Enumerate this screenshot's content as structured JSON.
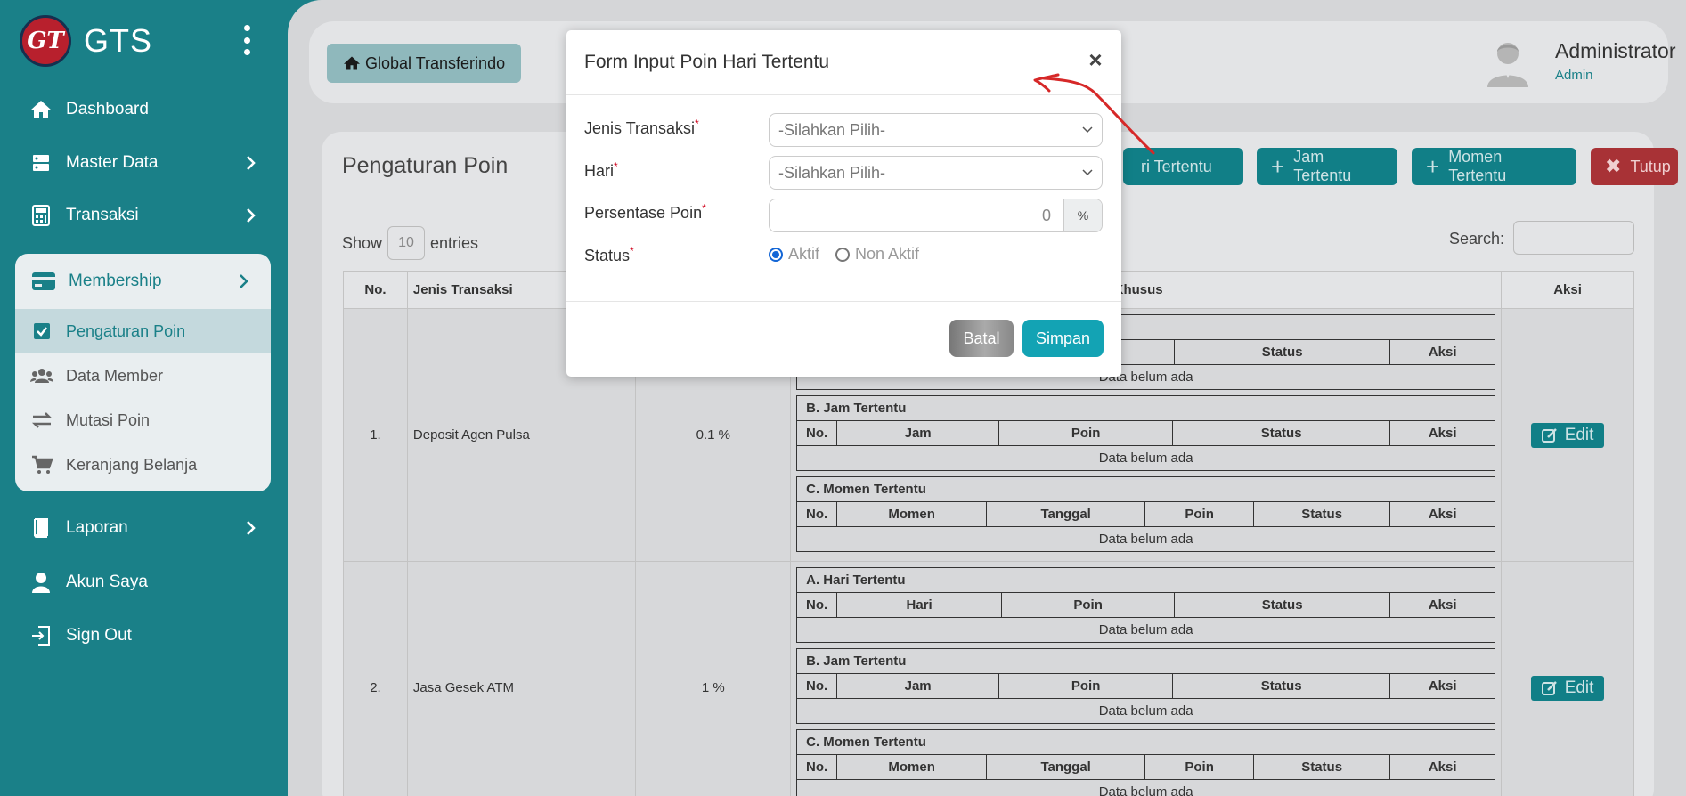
{
  "brand": {
    "logo_text": "GT",
    "name": "GTS"
  },
  "sidebar": {
    "items": [
      {
        "label": "Dashboard",
        "icon": "home-icon"
      },
      {
        "label": "Master Data",
        "icon": "server-icon"
      },
      {
        "label": "Transaksi",
        "icon": "calculator-icon"
      },
      {
        "label": "Membership",
        "icon": "card-icon"
      },
      {
        "label": "Laporan",
        "icon": "book-icon"
      },
      {
        "label": "Akun Saya",
        "icon": "user-icon"
      },
      {
        "label": "Sign Out",
        "icon": "signout-icon"
      }
    ],
    "membership_sub": [
      {
        "label": "Pengaturan Poin",
        "icon": "check-square-icon"
      },
      {
        "label": "Data Member",
        "icon": "users-icon"
      },
      {
        "label": "Mutasi Poin",
        "icon": "exchange-icon"
      },
      {
        "label": "Keranjang Belanja",
        "icon": "cart-icon"
      }
    ]
  },
  "topbar": {
    "breadcrumb": "Global Transferindo",
    "user_name": "Administrator",
    "user_role": "Admin"
  },
  "page": {
    "title": "Pengaturan Poin",
    "actions": {
      "hari": "ri Tertentu",
      "jam": "Jam Tertentu",
      "momen": "Momen Tertentu",
      "tutup": "Tutup"
    },
    "show_label": "Show",
    "entries_value": "10",
    "entries_label": "entries",
    "search_label": "Search:"
  },
  "table": {
    "headers": {
      "no": "No.",
      "jenis": "Jenis Transaksi",
      "khusus": "in Khusus",
      "aksi": "Aksi"
    },
    "rows": [
      {
        "no": "1.",
        "jenis": "Deposit Agen Pulsa",
        "poin": "0.1 %"
      },
      {
        "no": "2.",
        "jenis": "Jasa Gesek ATM",
        "poin": "1 %"
      }
    ],
    "sub": {
      "hari_title": "A. Hari Tertentu",
      "jam_title": "B. Jam Tertentu",
      "momen_title": "C. Momen Tertentu",
      "no": "No.",
      "hari": "Hari",
      "jam": "Jam",
      "momen": "Momen",
      "tanggal": "Tanggal",
      "poin": "Poin",
      "status": "Status",
      "aksi": "Aksi",
      "empty": "Data belum ada"
    },
    "edit_label": "Edit"
  },
  "modal": {
    "title": "Form Input Poin Hari Tertentu",
    "fields": {
      "jenis_label": "Jenis Transaksi",
      "jenis_value": "-Silahkan Pilih-",
      "hari_label": "Hari",
      "hari_value": "-Silahkan Pilih-",
      "persen_label": "Persentase Poin",
      "persen_value": "0",
      "persen_addon": "%",
      "status_label": "Status",
      "status_on": "Aktif",
      "status_off": "Non Aktif",
      "required_mark": "*"
    },
    "buttons": {
      "batal": "Batal",
      "simpan": "Simpan"
    }
  },
  "colors": {
    "teal": "#1a8088",
    "accent": "#13a3b4",
    "danger": "#a83236",
    "annotation": "#d62828"
  }
}
